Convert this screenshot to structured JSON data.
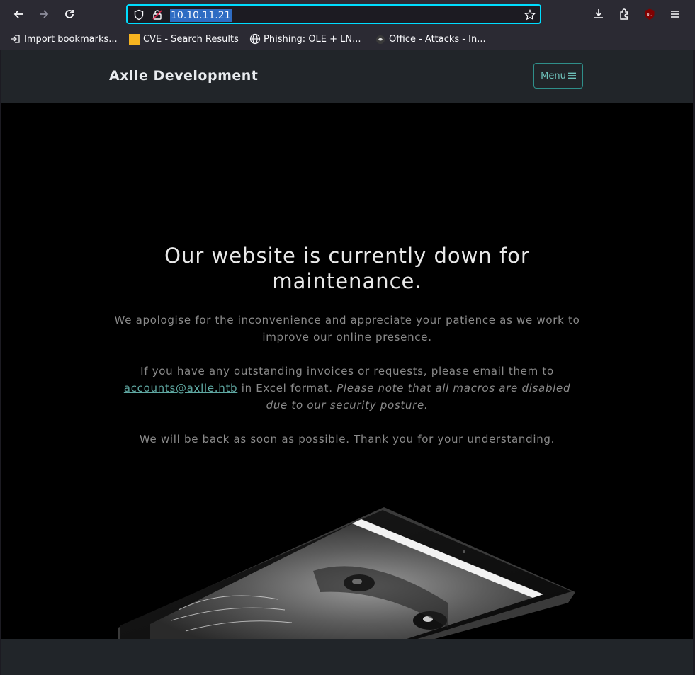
{
  "browser": {
    "url": "10.10.11.21",
    "bookmarks": [
      {
        "label": "Import bookmarks...",
        "icon": "import-icon"
      },
      {
        "label": "CVE - Search Results",
        "icon": "cve-favicon"
      },
      {
        "label": "Phishing: OLE + LN...",
        "icon": "globe-icon"
      },
      {
        "label": "Office - Attacks - In...",
        "icon": "office-favicon"
      }
    ]
  },
  "site": {
    "brand": "Axlle Development",
    "menu_label": "Menu",
    "title": "Our website is currently down for maintenance.",
    "p1": "We apologise for the inconvenience and appreciate your patience as we work to improve our online presence.",
    "p2_prefix": "If you have any outstanding invoices or requests, please email them to",
    "email": "accounts@axlle.htb",
    "p2_mid": "in Excel format.",
    "p2_italic": "Please note that all macros are disabled due to our security posture.",
    "p3": "We will be back as soon as possible. Thank you for your understanding."
  },
  "colors": {
    "url_focus": "#00ddff",
    "accent_teal": "#2f8f8a"
  }
}
